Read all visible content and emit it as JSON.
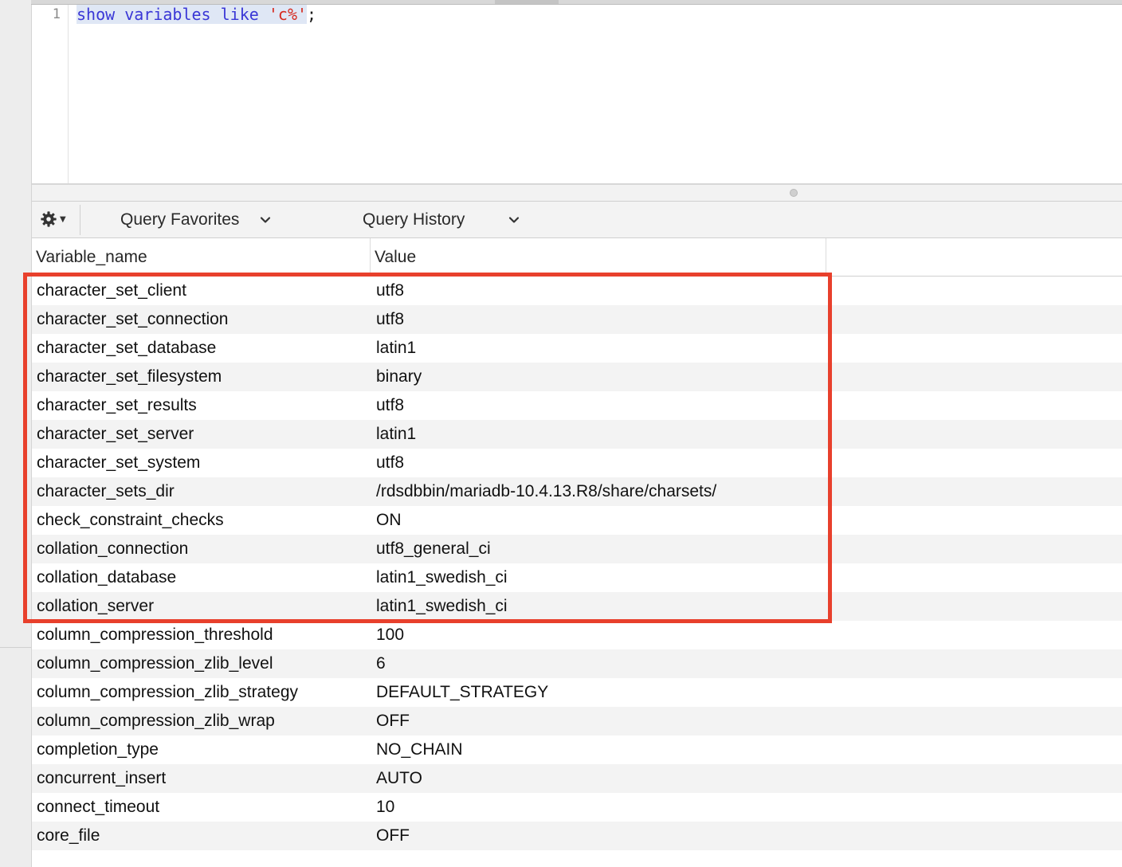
{
  "editor": {
    "line_number": "1",
    "code": {
      "kw1": "show",
      "kw2": "variables",
      "kw3": "like",
      "str": "'c%'",
      "end": ";"
    }
  },
  "toolbar": {
    "query_favorites": "Query Favorites",
    "query_history": "Query History"
  },
  "grid": {
    "columns": [
      "Variable_name",
      "Value"
    ],
    "rows": [
      {
        "name": "character_set_client",
        "value": "utf8"
      },
      {
        "name": "character_set_connection",
        "value": "utf8"
      },
      {
        "name": "character_set_database",
        "value": "latin1"
      },
      {
        "name": "character_set_filesystem",
        "value": "binary"
      },
      {
        "name": "character_set_results",
        "value": "utf8"
      },
      {
        "name": "character_set_server",
        "value": "latin1"
      },
      {
        "name": "character_set_system",
        "value": "utf8"
      },
      {
        "name": "character_sets_dir",
        "value": "/rdsdbbin/mariadb-10.4.13.R8/share/charsets/"
      },
      {
        "name": "check_constraint_checks",
        "value": "ON"
      },
      {
        "name": "collation_connection",
        "value": "utf8_general_ci"
      },
      {
        "name": "collation_database",
        "value": "latin1_swedish_ci"
      },
      {
        "name": "collation_server",
        "value": "latin1_swedish_ci"
      },
      {
        "name": "column_compression_threshold",
        "value": "100"
      },
      {
        "name": "column_compression_zlib_level",
        "value": "6"
      },
      {
        "name": "column_compression_zlib_strategy",
        "value": "DEFAULT_STRATEGY"
      },
      {
        "name": "column_compression_zlib_wrap",
        "value": "OFF"
      },
      {
        "name": "completion_type",
        "value": "NO_CHAIN"
      },
      {
        "name": "concurrent_insert",
        "value": "AUTO"
      },
      {
        "name": "connect_timeout",
        "value": "10"
      },
      {
        "name": "core_file",
        "value": "OFF"
      }
    ]
  },
  "colors": {
    "highlight": "#e8402c",
    "keyword": "#3a37d6",
    "string": "#d62a1f"
  },
  "icons": {
    "gear": "gear-icon",
    "dropdown": "chevron-down-icon"
  }
}
